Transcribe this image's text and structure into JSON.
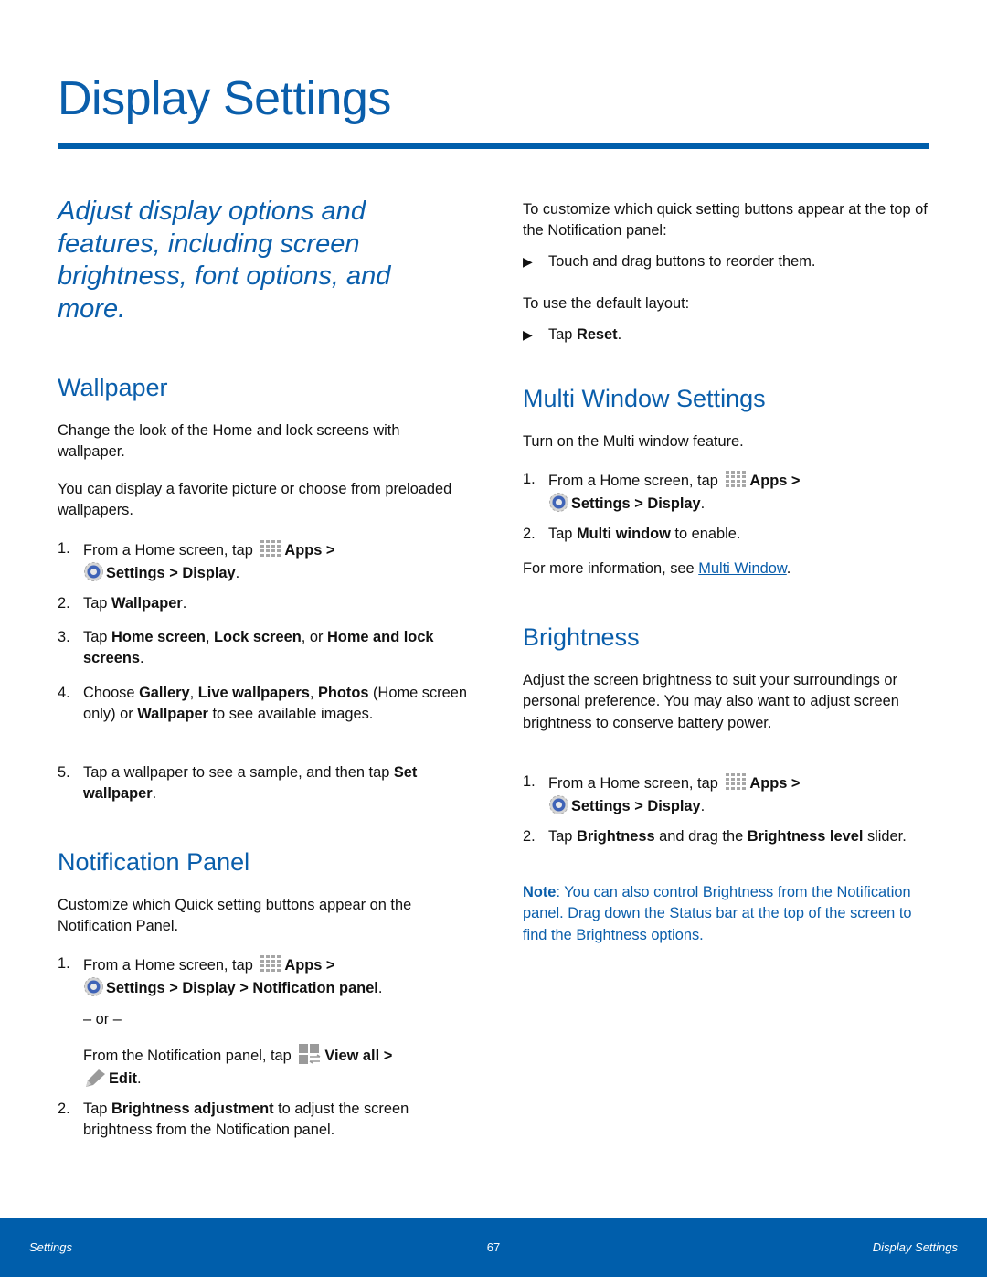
{
  "page": {
    "title": "Display Settings",
    "intro": "Adjust display options and features, including screen brightness, font options, and more.",
    "accent_color": "#005eab"
  },
  "wallpaper": {
    "heading": "Wallpaper",
    "para1": "Change the look of the Home and lock screens with wallpaper.",
    "para2": "You can display a favorite picture or choose from preloaded wallpapers.",
    "step1": {
      "num": "1.",
      "pre": "From a Home screen, tap ",
      "apps": "Apps",
      "gt1": " >",
      "settings": "Settings",
      "gt2": " > ",
      "display": "Display",
      "end": "."
    },
    "step2": {
      "num": "2.",
      "pre": "Tap ",
      "b1": "Wallpaper",
      "end": "."
    },
    "step3": {
      "num": "3.",
      "pre": "Tap ",
      "b1": "Home screen",
      "s1": ", ",
      "b2": "Lock screen",
      "s2": ", or ",
      "b3": "Home and lock screens",
      "end": "."
    },
    "step4": {
      "num": "4.",
      "pre": "Choose ",
      "b1": "Gallery",
      "s1": ", ",
      "b2": "Live wallpapers",
      "s2": ", ",
      "b3": "Photos",
      "s3": " (Home screen only) or ",
      "b4": "Wallpaper",
      "end": " to see available images."
    },
    "step5": {
      "num": "5.",
      "pre": "Tap a wallpaper to see a sample, and then tap ",
      "b1": "Set wallpaper",
      "end": "."
    }
  },
  "notification": {
    "heading": "Notification Panel",
    "para1": "Customize which Quick setting buttons appear on the Notification Panel.",
    "step1": {
      "num": "1.",
      "pre": "From a Home screen, tap ",
      "apps": "Apps",
      "gt1": " >",
      "settings": "Settings",
      "gt2": " > ",
      "display": "Display",
      "gt3": " > ",
      "panel": "Notification panel",
      "end": "."
    },
    "or": "– or –",
    "alt": {
      "pre": "From the Notification panel, tap ",
      "viewall": "View all >",
      "edit": "Edit",
      "end": "."
    },
    "step2": {
      "num": "2.",
      "pre": "Tap ",
      "b1": "Brightness adjustment",
      "end": " to adjust the screen brightness from the Notification panel."
    }
  },
  "right_top": {
    "para1": "To customize which quick setting buttons appear at the top of the Notification panel:",
    "bullet1": "Touch and drag buttons to reorder them.",
    "para2": "To use the default layout:",
    "bullet2": {
      "pre": "Tap ",
      "b1": "Reset",
      "end": "."
    }
  },
  "multiwindow": {
    "heading": "Multi Window Settings",
    "para1": "Turn on the Multi window feature.",
    "step1": {
      "num": "1.",
      "pre": "From a Home screen, tap ",
      "apps": "Apps",
      "gt1": " >",
      "settings": "Settings",
      "gt2": " > ",
      "display": "Display",
      "end": "."
    },
    "step2": {
      "num": "2.",
      "pre": "Tap ",
      "b1": "Multi window",
      "end": " to enable."
    },
    "more": {
      "pre": "For more information, see ",
      "link": "Multi Window",
      "end": "."
    }
  },
  "brightness": {
    "heading": "Brightness",
    "para1": "Adjust the screen brightness to suit your surroundings or personal preference. You may also want to adjust screen brightness to conserve battery power.",
    "step1": {
      "num": "1.",
      "pre": "From a Home screen, tap ",
      "apps": "Apps",
      "gt1": " >",
      "settings": "Settings",
      "gt2": " > ",
      "display": "Display",
      "end": "."
    },
    "step2": {
      "num": "2.",
      "pre": "Tap ",
      "b1": "Brightness",
      "s1": " and drag the ",
      "b2": "Brightness level",
      "end": " slider."
    },
    "note": {
      "label": "Note",
      "text": ": You can also control Brightness from the Notification panel. Drag down the Status bar at the top of the screen to find the Brightness options."
    }
  },
  "footer": {
    "left": "Settings",
    "page_number": "67",
    "right": "Display Settings"
  },
  "icons": {
    "apps": "apps-grid-icon",
    "settings": "settings-gear-icon",
    "view_all": "view-all-icon",
    "edit": "edit-pencil-icon",
    "bullet": "triangle-bullet-icon"
  }
}
